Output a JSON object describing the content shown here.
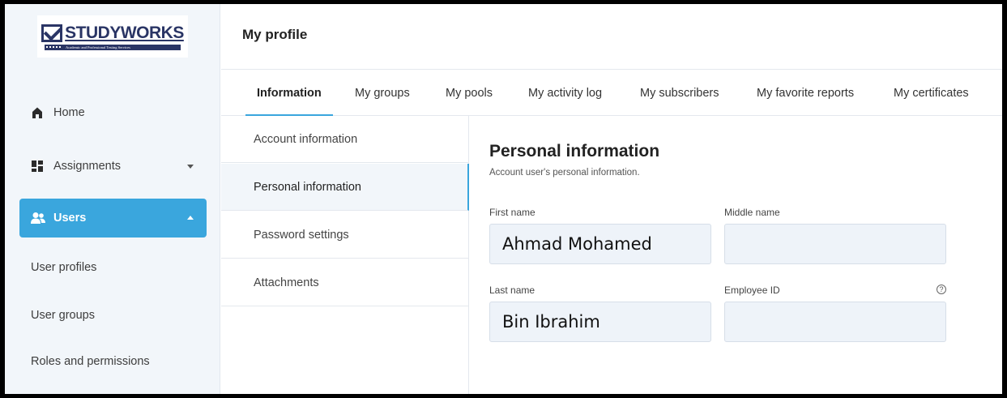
{
  "brand": {
    "name": "STUDYWORKS",
    "tagline": "Academic and Professional Testing Services"
  },
  "sidebar": {
    "items": [
      {
        "label": "Home",
        "icon": "home-icon"
      },
      {
        "label": "Assignments",
        "icon": "assignments-icon"
      },
      {
        "label": "Users",
        "icon": "users-icon"
      }
    ],
    "users_submenu": [
      "User profiles",
      "User groups",
      "Roles and permissions"
    ]
  },
  "header": {
    "title": "My profile"
  },
  "tabs": [
    "Information",
    "My groups",
    "My pools",
    "My activity log",
    "My subscribers",
    "My favorite reports",
    "My certificates"
  ],
  "subnav": [
    "Account information",
    "Personal information",
    "Password settings",
    "Attachments"
  ],
  "personal": {
    "title": "Personal information",
    "subtitle": "Account user's personal information.",
    "first_name_label": "First name",
    "first_name": "Ahmad Mohamed",
    "middle_name_label": "Middle name",
    "middle_name": "",
    "last_name_label": "Last name",
    "last_name": "Bin Ibrahim",
    "employee_id_label": "Employee ID",
    "employee_id": ""
  },
  "colors": {
    "accent": "#3aa6dd",
    "brand": "#2a3565",
    "sidebar_bg": "#f2f6fa"
  }
}
